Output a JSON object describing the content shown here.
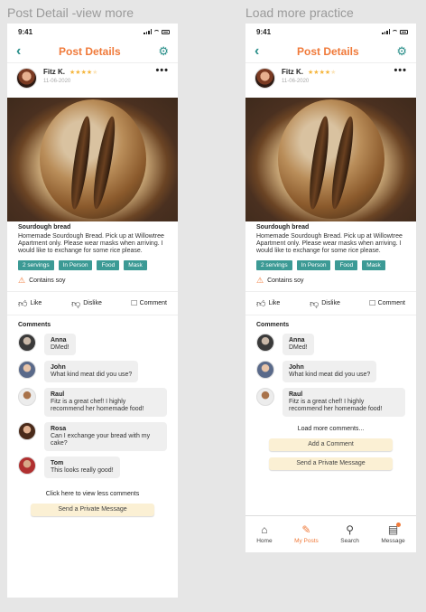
{
  "frames": {
    "left_label": "Post Detail -view more",
    "right_label": "Load more practice"
  },
  "colors": {
    "accent": "#f07a3a",
    "teal": "#2a8f8a",
    "tag": "#3c9a95",
    "button": "#fbf0d4"
  },
  "status": {
    "time": "9:41"
  },
  "header": {
    "title": "Post Details",
    "back_icon": "chevron-left-icon",
    "settings_icon": "gear-icon"
  },
  "post": {
    "author": "Fitz K.",
    "rating": 4,
    "stars": "★★★★★",
    "date": "11-06-2020",
    "title": "Sourdough bread",
    "description": "Homemade Sourdough Bread. Pick up at Willowtree Apartment only. Please wear masks when arriving. I would like to exchange for some rice please.",
    "tags": [
      "2 servings",
      "In Person",
      "Food",
      "Mask"
    ],
    "allergen": "Contains soy"
  },
  "actions": {
    "like": "Like",
    "dislike": "Dislike",
    "comment": "Comment"
  },
  "comments_title": "Comments",
  "comments": [
    {
      "name": "Anna",
      "text": "DMed!"
    },
    {
      "name": "John",
      "text": "What kind meat did you use?"
    },
    {
      "name": "Raul",
      "text": "Fitz is a great chef! I highly recommend her homemade food!"
    },
    {
      "name": "Rosa",
      "text": "Can I exchange your bread with my cake?"
    },
    {
      "name": "Tom",
      "text": "This looks really good!"
    }
  ],
  "left_footer": {
    "view_less": "Click here to view less comments",
    "private_message": "Send a Private Message"
  },
  "right_footer": {
    "load_more": "Load more comments...",
    "add_comment": "Add a Comment",
    "private_message": "Send a Private Message"
  },
  "nav": [
    {
      "label": "Home",
      "icon": "home-icon"
    },
    {
      "label": "My Posts",
      "icon": "edit-icon",
      "active": true
    },
    {
      "label": "Search",
      "icon": "search-icon"
    },
    {
      "label": "Message",
      "icon": "message-icon"
    }
  ]
}
